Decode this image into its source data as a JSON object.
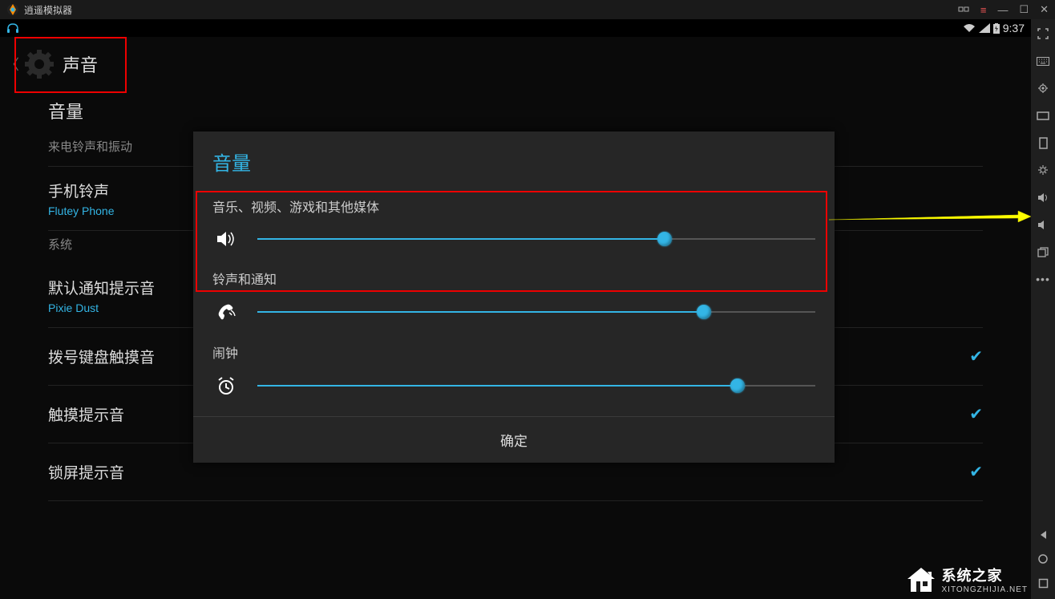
{
  "titlebar": {
    "app_name": "逍遥模拟器"
  },
  "statusbar": {
    "time": "9:37"
  },
  "header": {
    "title": "声音"
  },
  "settings": {
    "section_volume": "音量",
    "ringtone_vibrate": "来电铃声和振动",
    "phone_ringtone": {
      "label": "手机铃声",
      "value": "Flutey Phone"
    },
    "system": "系统",
    "default_notification": {
      "label": "默认通知提示音",
      "value": "Pixie Dust"
    },
    "dialpad_touch": "拨号键盘触摸音",
    "touch_sound": "触摸提示音",
    "lock_sound": "锁屏提示音"
  },
  "dialog": {
    "title": "音量",
    "sliders": {
      "media": {
        "label": "音乐、视频、游戏和其他媒体",
        "percent": 73
      },
      "ringtone": {
        "label": "铃声和通知",
        "percent": 80
      },
      "alarm": {
        "label": "闹钟",
        "percent": 86
      }
    },
    "confirm": "确定"
  },
  "watermark": {
    "brand": "系统之家",
    "url": "XITONGZHIJIA.NET"
  }
}
